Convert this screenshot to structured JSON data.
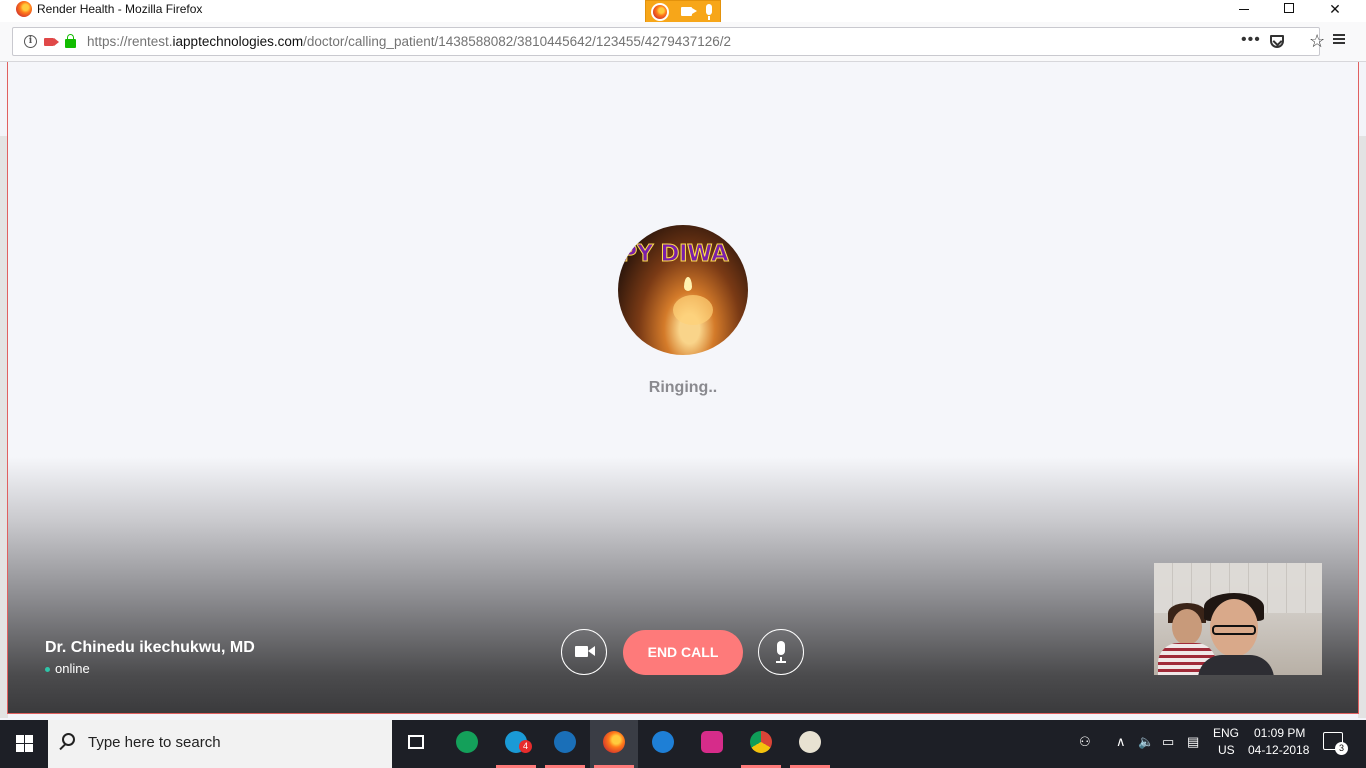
{
  "window": {
    "title": "Render Health - Mozilla Firefox"
  },
  "navbar": {
    "url_prefix": "https://rentest.",
    "url_domain": "iapptechnologies.com",
    "url_path": "/doctor/calling_patient/1438588082/3810445642/123455/4279437126/2",
    "more_label": "•••"
  },
  "call": {
    "avatar_banner": "PPY DIWA",
    "status_text": "Ringing..",
    "doctor_name": "Dr. Chinedu ikechukwu, MD",
    "presence": "online",
    "end_call_label": "END CALL"
  },
  "taskbar": {
    "search_placeholder": "Type here to search",
    "skype_badge": "4",
    "language": "ENG",
    "region": "US",
    "time": "01:09 PM",
    "date": "04-12-2018",
    "notifications_count": "3"
  },
  "colors": {
    "end_call": "#fe7a7a",
    "online_dot": "#2ec5a9",
    "media_indicator": "#f7a619",
    "lock": "#12bc00"
  }
}
